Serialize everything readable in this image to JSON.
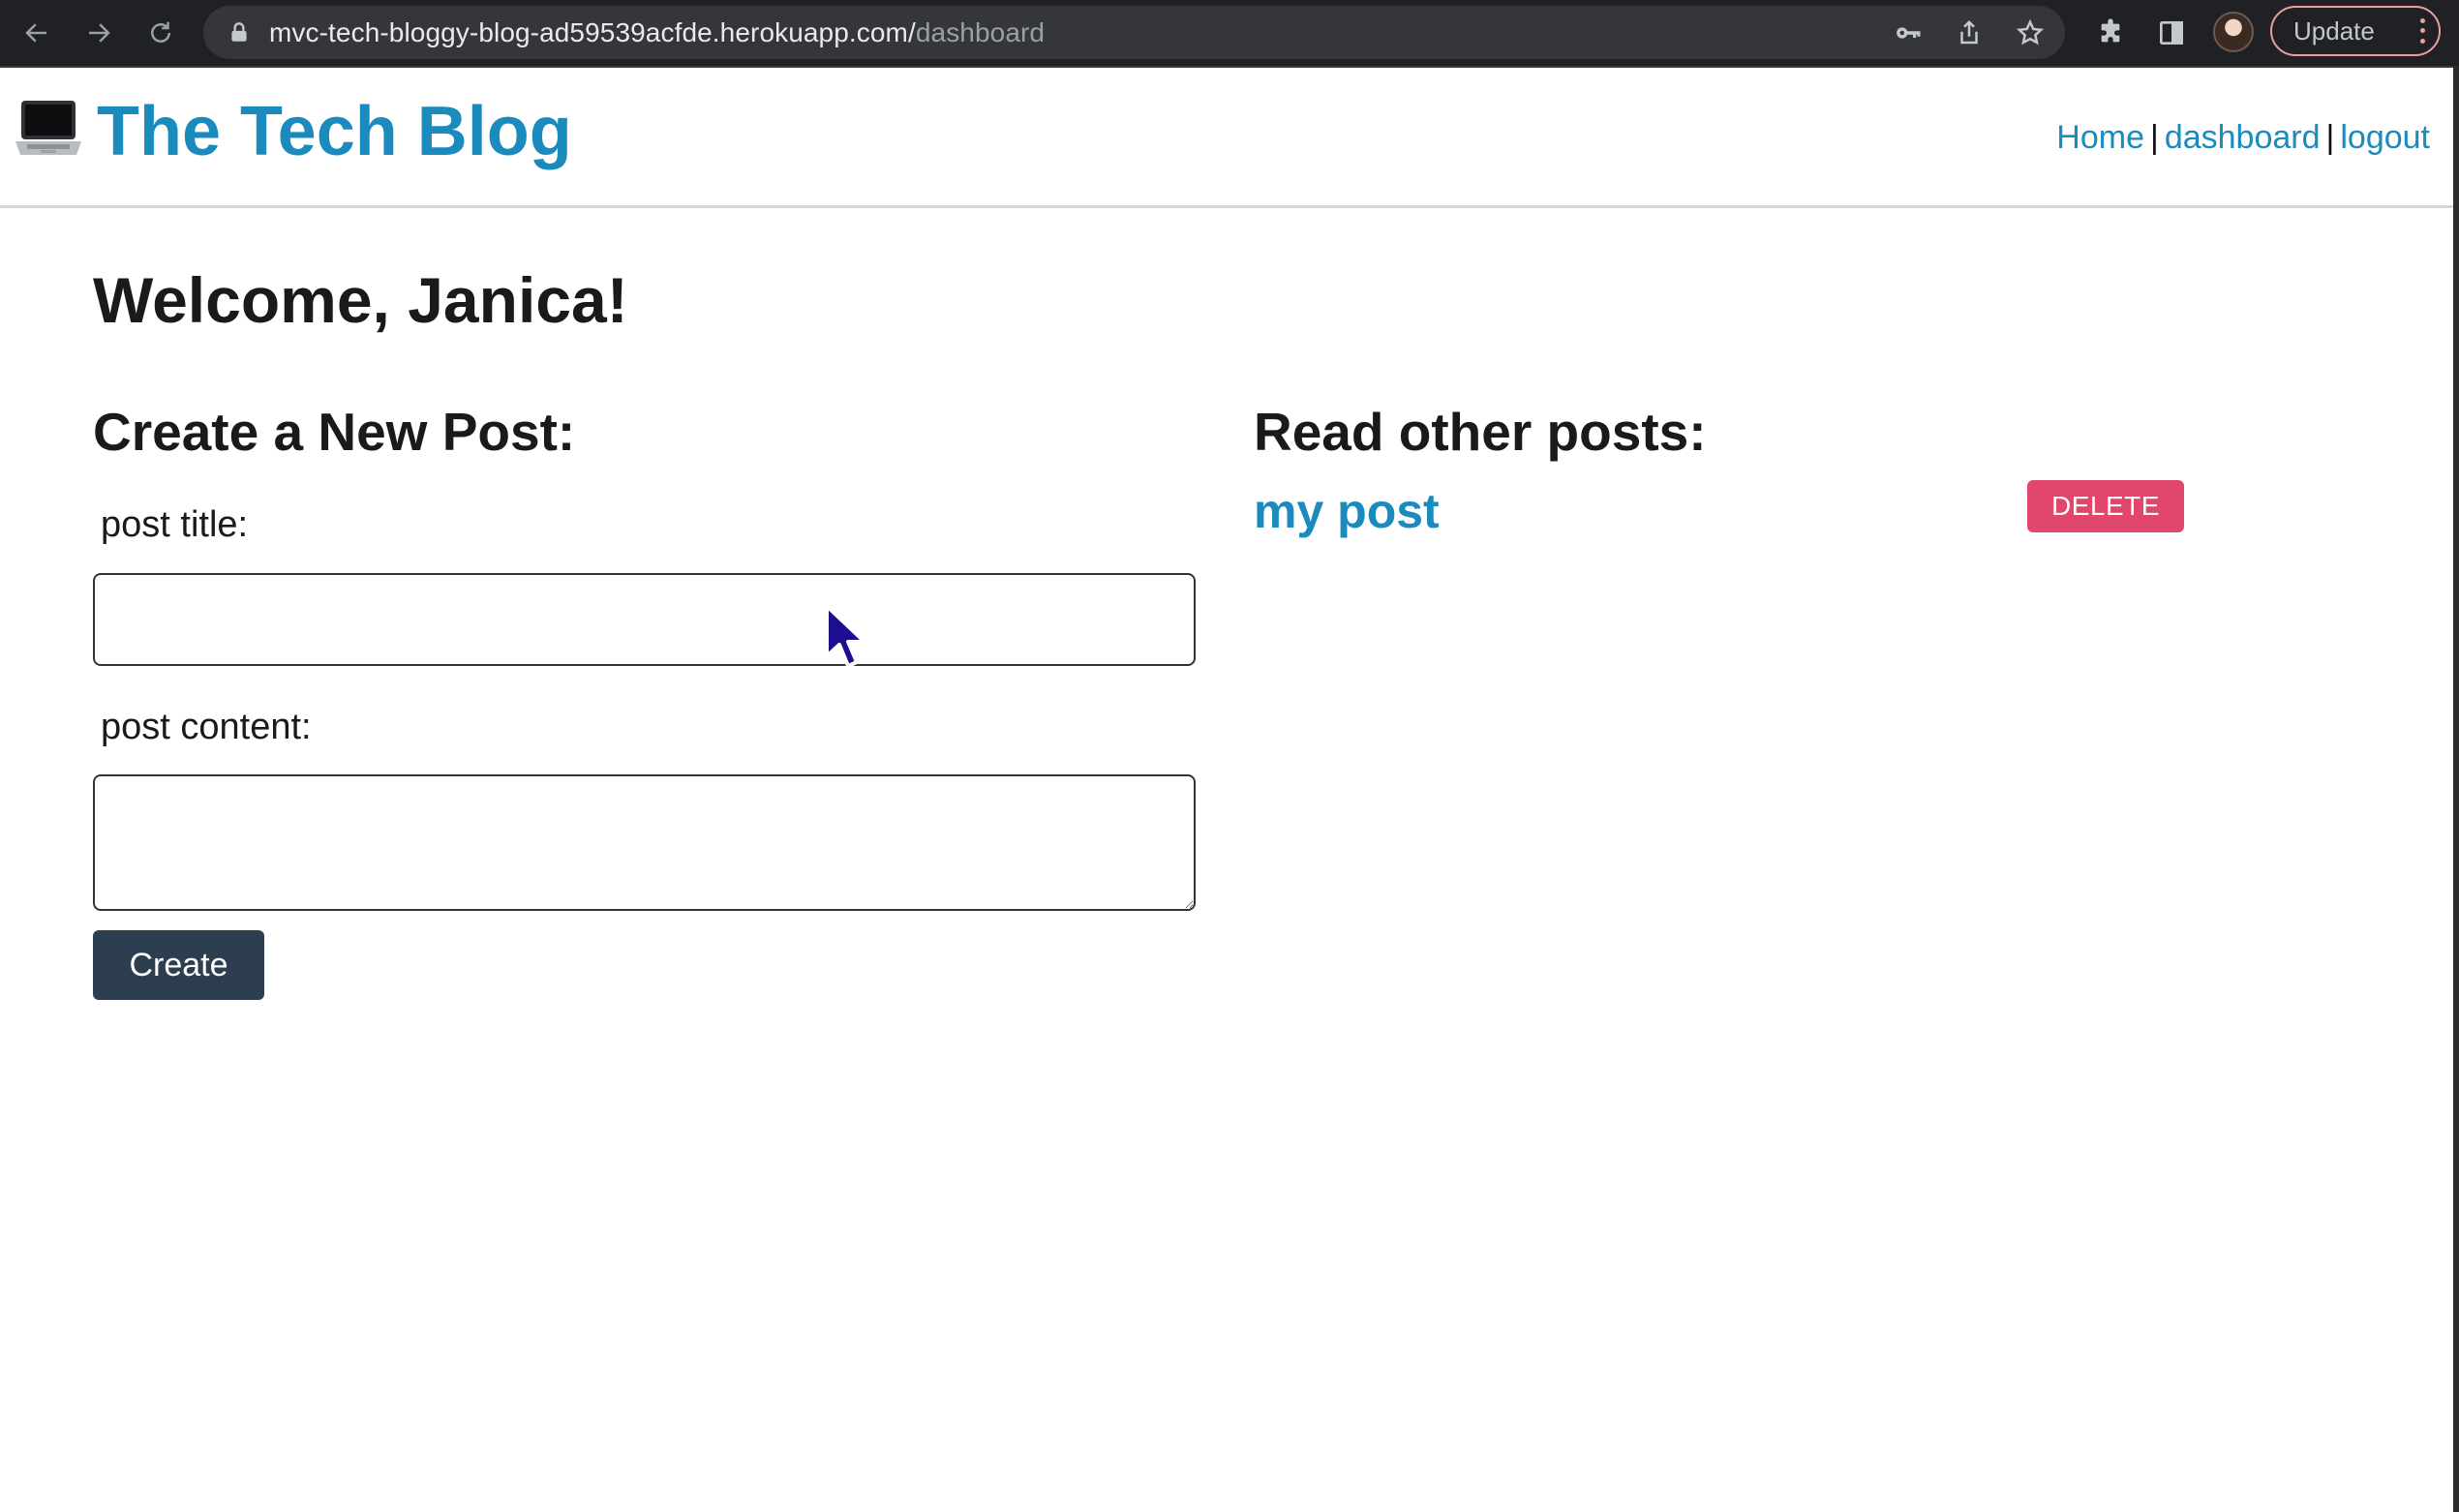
{
  "browser": {
    "url_host": "mvc-tech-bloggy-blog-ad59539acfde.herokuapp.com/",
    "url_path": "dashboard",
    "update_label": "Update"
  },
  "header": {
    "logo_icon": "laptop-icon",
    "title": "The Tech Blog",
    "nav": {
      "home": "Home",
      "dashboard": "dashboard",
      "logout": "logout",
      "separator": "|"
    }
  },
  "main": {
    "welcome": "Welcome, Janica!",
    "create": {
      "heading": "Create a New Post:",
      "title_label": "post title:",
      "title_value": "",
      "content_label": "post content:",
      "content_value": "",
      "submit_label": "Create"
    },
    "read": {
      "heading": "Read other posts:",
      "posts": [
        {
          "title": "my post",
          "delete_label": "DELETE"
        }
      ]
    }
  },
  "colors": {
    "brand": "#1b8bbd",
    "create_button": "#2d3e50",
    "delete_button": "#e0476a"
  }
}
